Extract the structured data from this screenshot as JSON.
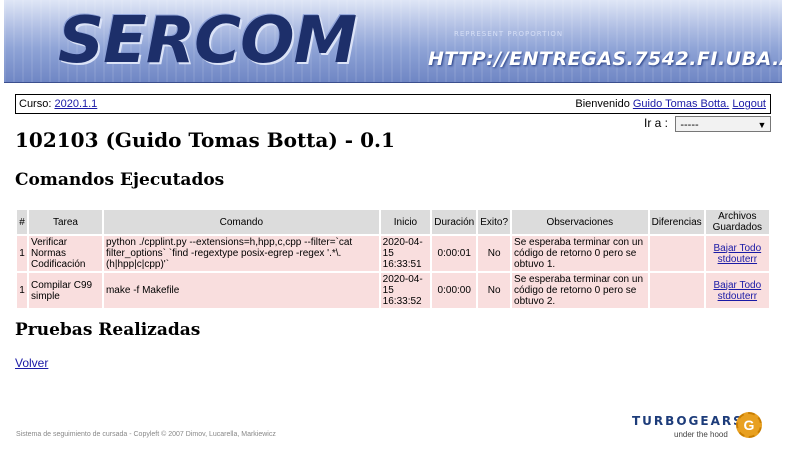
{
  "banner": {
    "logo": "SERCOM",
    "url": "HTTP://ENTREGAS.7542.FI.UBA.AR",
    "ghost_text": "REPRESENT PROPORTION"
  },
  "header": {
    "course_label": "Curso:",
    "course_link": "2020.1.1",
    "welcome_label": "Bienvenido",
    "user_link": "Guido Tomas Botta.",
    "logout_link": "Logout"
  },
  "goto": {
    "label": "Ir a :",
    "selected": "-----"
  },
  "page_title": "102103 (Guido Tomas Botta) - 0.1",
  "section_commands": "Comandos Ejecutados",
  "section_tests": "Pruebas Realizadas",
  "table": {
    "headers": [
      "#",
      "Tarea",
      "Comando",
      "Inicio",
      "Duración",
      "Exito?",
      "Observaciones",
      "Diferencias",
      "Archivos Guardados"
    ],
    "rows": [
      {
        "num": "1",
        "tarea": "Verificar Normas Codificación",
        "comando": "python ./cpplint.py --extensions=h,hpp,c,cpp --filter=`cat filter_options` `find -regextype posix-egrep -regex '.*\\.(h|hpp|c|cpp)'`",
        "inicio": "2020-04-15 16:33:51",
        "duracion": "0:00:01",
        "exito": "No",
        "observaciones": "Se esperaba terminar con un código de retorno 0 pero se obtuvo 1.",
        "diferencias": "",
        "archivos": [
          "Bajar Todo",
          "stdouterr"
        ]
      },
      {
        "num": "1",
        "tarea": "Compilar C99 simple",
        "comando": "make -f Makefile",
        "inicio": "2020-04-15 16:33:52",
        "duracion": "0:00:00",
        "exito": "No",
        "observaciones": "Se esperaba terminar con un código de retorno 0 pero se obtuvo 2.",
        "diferencias": "",
        "archivos": [
          "Bajar Todo",
          "stdouterr"
        ]
      }
    ]
  },
  "volver_link": "Volver",
  "footer": "Sistema de seguimiento de cursada - Copyleft © 2007 Dimov, Lucarella, Markiewicz",
  "turbogears": {
    "word": "TURBOGEARS",
    "sub": "under the hood",
    "gear_letter": "G"
  }
}
